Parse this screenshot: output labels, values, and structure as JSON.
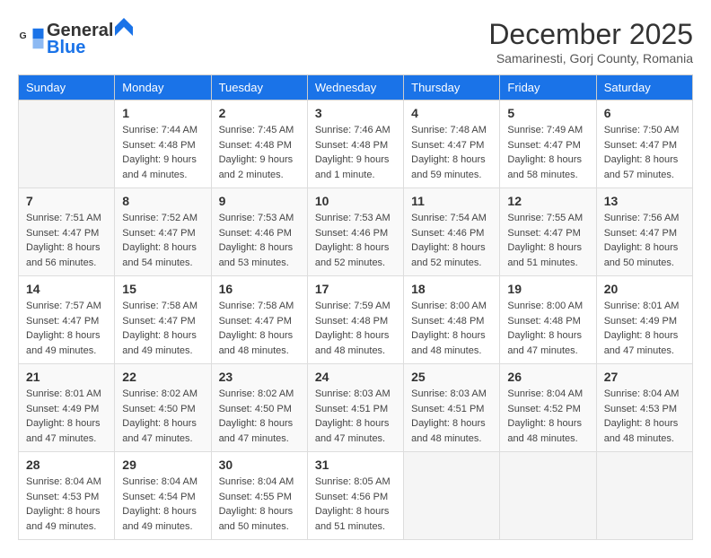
{
  "logo": {
    "line1": "General",
    "line2": "Blue"
  },
  "title": "December 2025",
  "subtitle": "Samarinesti, Gorj County, Romania",
  "days_header": [
    "Sunday",
    "Monday",
    "Tuesday",
    "Wednesday",
    "Thursday",
    "Friday",
    "Saturday"
  ],
  "weeks": [
    [
      {
        "day": "",
        "info": ""
      },
      {
        "day": "1",
        "info": "Sunrise: 7:44 AM\nSunset: 4:48 PM\nDaylight: 9 hours\nand 4 minutes."
      },
      {
        "day": "2",
        "info": "Sunrise: 7:45 AM\nSunset: 4:48 PM\nDaylight: 9 hours\nand 2 minutes."
      },
      {
        "day": "3",
        "info": "Sunrise: 7:46 AM\nSunset: 4:48 PM\nDaylight: 9 hours\nand 1 minute."
      },
      {
        "day": "4",
        "info": "Sunrise: 7:48 AM\nSunset: 4:47 PM\nDaylight: 8 hours\nand 59 minutes."
      },
      {
        "day": "5",
        "info": "Sunrise: 7:49 AM\nSunset: 4:47 PM\nDaylight: 8 hours\nand 58 minutes."
      },
      {
        "day": "6",
        "info": "Sunrise: 7:50 AM\nSunset: 4:47 PM\nDaylight: 8 hours\nand 57 minutes."
      }
    ],
    [
      {
        "day": "7",
        "info": "Sunrise: 7:51 AM\nSunset: 4:47 PM\nDaylight: 8 hours\nand 56 minutes."
      },
      {
        "day": "8",
        "info": "Sunrise: 7:52 AM\nSunset: 4:47 PM\nDaylight: 8 hours\nand 54 minutes."
      },
      {
        "day": "9",
        "info": "Sunrise: 7:53 AM\nSunset: 4:46 PM\nDaylight: 8 hours\nand 53 minutes."
      },
      {
        "day": "10",
        "info": "Sunrise: 7:53 AM\nSunset: 4:46 PM\nDaylight: 8 hours\nand 52 minutes."
      },
      {
        "day": "11",
        "info": "Sunrise: 7:54 AM\nSunset: 4:46 PM\nDaylight: 8 hours\nand 52 minutes."
      },
      {
        "day": "12",
        "info": "Sunrise: 7:55 AM\nSunset: 4:47 PM\nDaylight: 8 hours\nand 51 minutes."
      },
      {
        "day": "13",
        "info": "Sunrise: 7:56 AM\nSunset: 4:47 PM\nDaylight: 8 hours\nand 50 minutes."
      }
    ],
    [
      {
        "day": "14",
        "info": "Sunrise: 7:57 AM\nSunset: 4:47 PM\nDaylight: 8 hours\nand 49 minutes."
      },
      {
        "day": "15",
        "info": "Sunrise: 7:58 AM\nSunset: 4:47 PM\nDaylight: 8 hours\nand 49 minutes."
      },
      {
        "day": "16",
        "info": "Sunrise: 7:58 AM\nSunset: 4:47 PM\nDaylight: 8 hours\nand 48 minutes."
      },
      {
        "day": "17",
        "info": "Sunrise: 7:59 AM\nSunset: 4:48 PM\nDaylight: 8 hours\nand 48 minutes."
      },
      {
        "day": "18",
        "info": "Sunrise: 8:00 AM\nSunset: 4:48 PM\nDaylight: 8 hours\nand 48 minutes."
      },
      {
        "day": "19",
        "info": "Sunrise: 8:00 AM\nSunset: 4:48 PM\nDaylight: 8 hours\nand 47 minutes."
      },
      {
        "day": "20",
        "info": "Sunrise: 8:01 AM\nSunset: 4:49 PM\nDaylight: 8 hours\nand 47 minutes."
      }
    ],
    [
      {
        "day": "21",
        "info": "Sunrise: 8:01 AM\nSunset: 4:49 PM\nDaylight: 8 hours\nand 47 minutes."
      },
      {
        "day": "22",
        "info": "Sunrise: 8:02 AM\nSunset: 4:50 PM\nDaylight: 8 hours\nand 47 minutes."
      },
      {
        "day": "23",
        "info": "Sunrise: 8:02 AM\nSunset: 4:50 PM\nDaylight: 8 hours\nand 47 minutes."
      },
      {
        "day": "24",
        "info": "Sunrise: 8:03 AM\nSunset: 4:51 PM\nDaylight: 8 hours\nand 47 minutes."
      },
      {
        "day": "25",
        "info": "Sunrise: 8:03 AM\nSunset: 4:51 PM\nDaylight: 8 hours\nand 48 minutes."
      },
      {
        "day": "26",
        "info": "Sunrise: 8:04 AM\nSunset: 4:52 PM\nDaylight: 8 hours\nand 48 minutes."
      },
      {
        "day": "27",
        "info": "Sunrise: 8:04 AM\nSunset: 4:53 PM\nDaylight: 8 hours\nand 48 minutes."
      }
    ],
    [
      {
        "day": "28",
        "info": "Sunrise: 8:04 AM\nSunset: 4:53 PM\nDaylight: 8 hours\nand 49 minutes."
      },
      {
        "day": "29",
        "info": "Sunrise: 8:04 AM\nSunset: 4:54 PM\nDaylight: 8 hours\nand 49 minutes."
      },
      {
        "day": "30",
        "info": "Sunrise: 8:04 AM\nSunset: 4:55 PM\nDaylight: 8 hours\nand 50 minutes."
      },
      {
        "day": "31",
        "info": "Sunrise: 8:05 AM\nSunset: 4:56 PM\nDaylight: 8 hours\nand 51 minutes."
      },
      {
        "day": "",
        "info": ""
      },
      {
        "day": "",
        "info": ""
      },
      {
        "day": "",
        "info": ""
      }
    ]
  ]
}
